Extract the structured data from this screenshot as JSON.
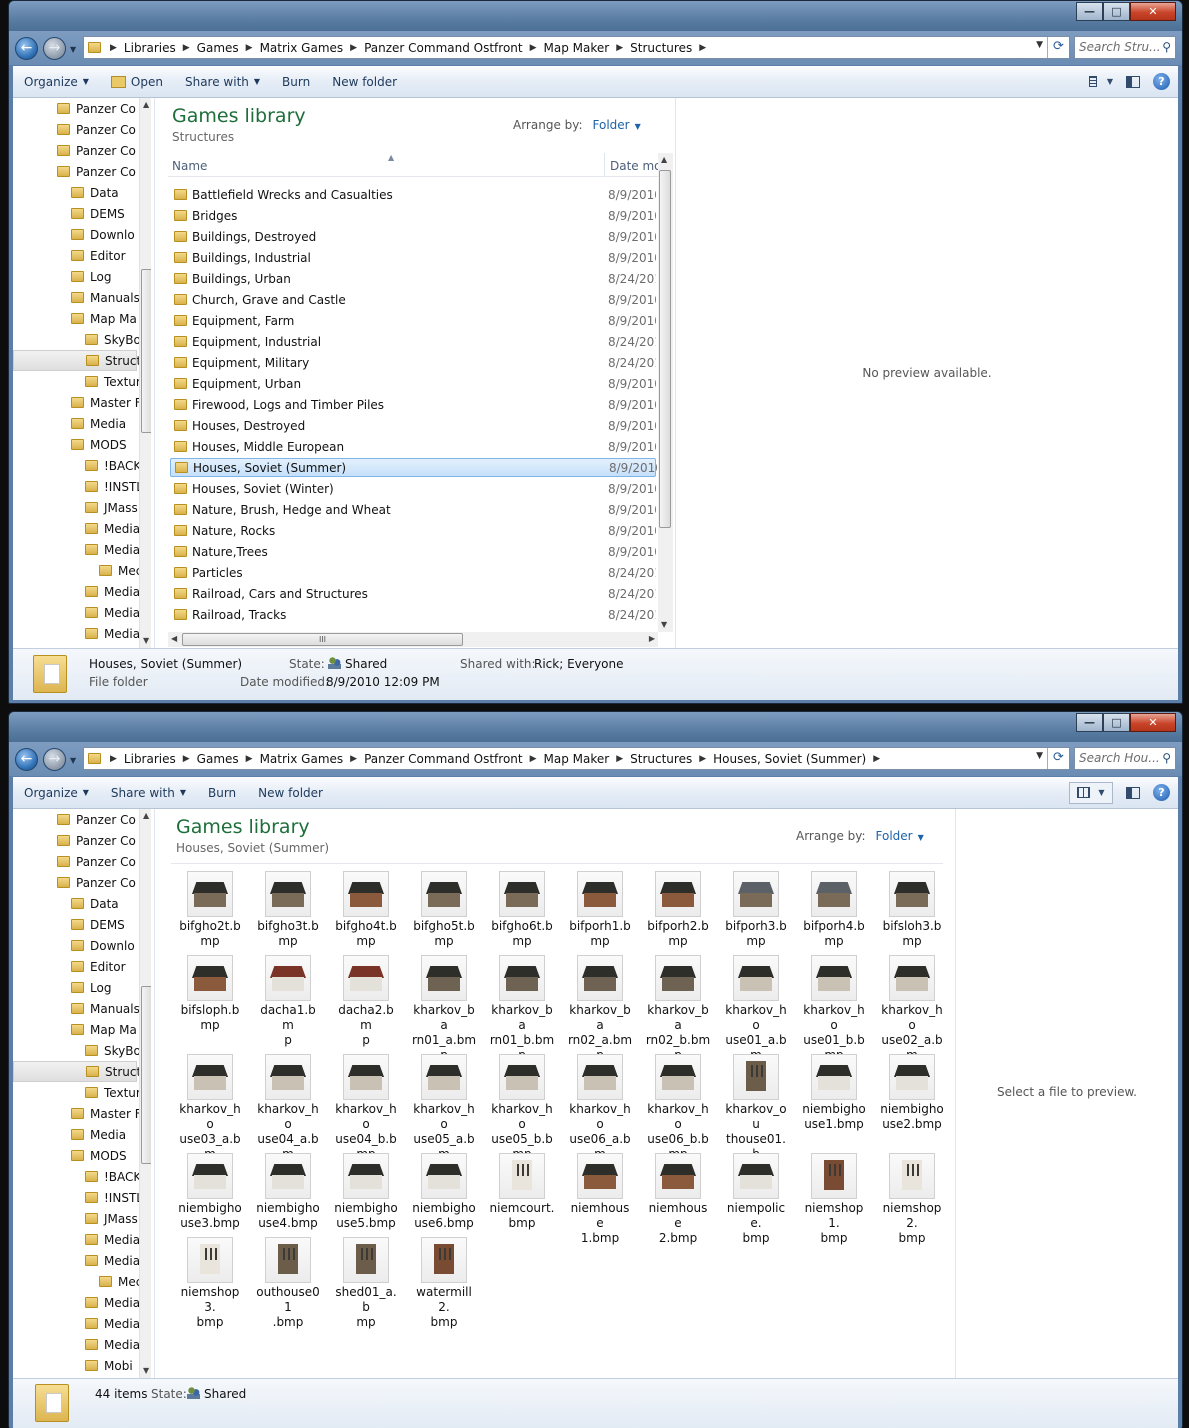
{
  "window1": {
    "address": [
      "Libraries",
      "Games",
      "Matrix Games",
      "Panzer Command Ostfront",
      "Map Maker",
      "Structures"
    ],
    "search_placeholder": "Search Stru...",
    "toolbar": {
      "organize": "Organize",
      "open": "Open",
      "share_with": "Share with",
      "burn": "Burn",
      "new_folder": "New folder"
    },
    "tree": [
      "Panzer Co",
      "Panzer Co",
      "Panzer Co",
      "Panzer Co",
      "Data",
      "DEMS",
      "Downlo",
      "Editor",
      "Log",
      "Manuals",
      "Map Ma",
      "SkyBo",
      "Struct",
      "Textur",
      "Master F",
      "Media",
      "MODS",
      "!BACK",
      "!INSTL",
      "JMass",
      "Media",
      "Media",
      "Mec",
      "Media",
      "Media",
      "Media"
    ],
    "library_title": "Games library",
    "library_sub": "Structures",
    "arrange_label": "Arrange by:",
    "arrange_value": "Folder",
    "col_name": "Name",
    "col_date": "Date mo",
    "files": [
      {
        "name": "Battlefield Wrecks and Casualties",
        "date": "8/9/2010"
      },
      {
        "name": "Bridges",
        "date": "8/9/2010"
      },
      {
        "name": "Buildings, Destroyed",
        "date": "8/9/2010"
      },
      {
        "name": "Buildings, Industrial",
        "date": "8/9/2010"
      },
      {
        "name": "Buildings, Urban",
        "date": "8/24/201"
      },
      {
        "name": "Church, Grave and Castle",
        "date": "8/9/2010"
      },
      {
        "name": "Equipment, Farm",
        "date": "8/9/2010"
      },
      {
        "name": "Equipment, Industrial",
        "date": "8/24/201"
      },
      {
        "name": "Equipment, Military",
        "date": "8/24/201"
      },
      {
        "name": "Equipment, Urban",
        "date": "8/9/2010"
      },
      {
        "name": "Firewood, Logs and Timber Piles",
        "date": "8/9/2010"
      },
      {
        "name": "Houses, Destroyed",
        "date": "8/9/2010"
      },
      {
        "name": "Houses, Middle European",
        "date": "8/9/2010"
      },
      {
        "name": "Houses, Soviet (Summer)",
        "date": "8/9/2010"
      },
      {
        "name": "Houses, Soviet (Winter)",
        "date": "8/9/2010"
      },
      {
        "name": "Nature, Brush, Hedge and Wheat",
        "date": "8/9/2010"
      },
      {
        "name": "Nature, Rocks",
        "date": "8/9/2010"
      },
      {
        "name": "Nature,Trees",
        "date": "8/9/2010"
      },
      {
        "name": "Particles",
        "date": "8/24/201"
      },
      {
        "name": "Railroad, Cars and Structures",
        "date": "8/24/201"
      },
      {
        "name": "Railroad, Tracks",
        "date": "8/24/201"
      }
    ],
    "preview_msg": "No preview available.",
    "details": {
      "name": "Houses, Soviet (Summer)",
      "type": "File folder",
      "state_label": "State:",
      "state_value": "Shared",
      "shared_label": "Shared with:",
      "shared_value": "Rick; Everyone",
      "modified_label": "Date modified:",
      "modified_value": "8/9/2010 12:09 PM"
    }
  },
  "window2": {
    "address": [
      "Libraries",
      "Games",
      "Matrix Games",
      "Panzer Command Ostfront",
      "Map Maker",
      "Structures",
      "Houses, Soviet (Summer)"
    ],
    "search_placeholder": "Search Hou...",
    "toolbar": {
      "organize": "Organize",
      "share_with": "Share with",
      "burn": "Burn",
      "new_folder": "New folder"
    },
    "tree": [
      "Panzer Co",
      "Panzer Co",
      "Panzer Co",
      "Panzer Co",
      "Data",
      "DEMS",
      "Downlo",
      "Editor",
      "Log",
      "Manuals",
      "Map Ma",
      "SkyBo",
      "Struct",
      "Textur",
      "Master F",
      "Media",
      "MODS",
      "!BACK",
      "!INSTL",
      "JMass",
      "Media",
      "Media",
      "Mec",
      "Media",
      "Media",
      "Media",
      "Mobi"
    ],
    "library_title": "Games library",
    "library_sub": "Houses, Soviet (Summer)",
    "arrange_label": "Arrange by:",
    "arrange_value": "Folder",
    "files": [
      "bifgho2t.bmp",
      "bifgho3t.bmp",
      "bifgho4t.bmp",
      "bifgho5t.bmp",
      "bifgho6t.bmp",
      "bifporh1.bmp",
      "bifporh2.bmp",
      "bifporh3.bmp",
      "bifporh4.bmp",
      "bifsloh3.bmp",
      "bifsloph.bmp",
      "dacha1.bmp",
      "dacha2.bmp",
      "kharkov_barn01_a.bmp",
      "kharkov_barn01_b.bmp",
      "kharkov_barn02_a.bmp",
      "kharkov_barn02_b.bmp",
      "kharkov_house01_a.bmp",
      "kharkov_house01_b.bmp",
      "kharkov_house02_a.bmp",
      "kharkov_house03_a.bmp",
      "kharkov_house04_a.bmp",
      "kharkov_house04_b.bmp",
      "kharkov_house05_a.bmp",
      "kharkov_house05_b.bmp",
      "kharkov_house06_a.bmp",
      "kharkov_house06_b.bmp",
      "kharkov_outhouse01.bmp",
      "niembighouse1.bmp",
      "niembighouse2.bmp",
      "niembighouse3.bmp",
      "niembighouse4.bmp",
      "niembighouse5.bmp",
      "niembighouse6.bmp",
      "niemcourt.bmp",
      "niemhouse1.bmp",
      "niemhouse2.bmp",
      "niempolice.bmp",
      "niemshop1.bmp",
      "niemshop2.bmp",
      "niemshop3.bmp",
      "outhouse01.bmp",
      "shed01_a.bmp",
      "watermill2.bmp"
    ],
    "file_labels": [
      [
        "bifgho2t.b",
        "mp"
      ],
      [
        "bifgho3t.b",
        "mp"
      ],
      [
        "bifgho4t.b",
        "mp"
      ],
      [
        "bifgho5t.b",
        "mp"
      ],
      [
        "bifgho6t.b",
        "mp"
      ],
      [
        "bifporh1.b",
        "mp"
      ],
      [
        "bifporh2.b",
        "mp"
      ],
      [
        "bifporh3.b",
        "mp"
      ],
      [
        "bifporh4.b",
        "mp"
      ],
      [
        "bifsloh3.b",
        "mp"
      ],
      [
        "bifsloph.b",
        "mp"
      ],
      [
        "dacha1.bm",
        "p"
      ],
      [
        "dacha2.bm",
        "p"
      ],
      [
        "kharkov_ba",
        "rn01_a.bmp"
      ],
      [
        "kharkov_ba",
        "rn01_b.bm",
        "p"
      ],
      [
        "kharkov_ba",
        "rn02_a.bmp"
      ],
      [
        "kharkov_ba",
        "rn02_b.bm",
        "p"
      ],
      [
        "kharkov_ho",
        "use01_a.bm",
        "p"
      ],
      [
        "kharkov_ho",
        "use01_b.b",
        "mp"
      ],
      [
        "kharkov_ho",
        "use02_a.bm",
        "p"
      ],
      [
        "kharkov_ho",
        "use03_a.bm",
        "p"
      ],
      [
        "kharkov_ho",
        "use04_a.bm",
        "p"
      ],
      [
        "kharkov_ho",
        "use04_b.b",
        "mp"
      ],
      [
        "kharkov_ho",
        "use05_a.bm",
        "p"
      ],
      [
        "kharkov_ho",
        "use05_b.b",
        "mp"
      ],
      [
        "kharkov_ho",
        "use06_a.bm",
        "p"
      ],
      [
        "kharkov_ho",
        "use06_b.b",
        "mp"
      ],
      [
        "kharkov_ou",
        "thouse01.b",
        "mp"
      ],
      [
        "niembigho",
        "use1.bmp"
      ],
      [
        "niembigho",
        "use2.bmp"
      ],
      [
        "niembigho",
        "use3.bmp"
      ],
      [
        "niembigho",
        "use4.bmp"
      ],
      [
        "niembigho",
        "use5.bmp"
      ],
      [
        "niembigho",
        "use6.bmp"
      ],
      [
        "niemcourt.",
        "bmp"
      ],
      [
        "niemhouse",
        "1.bmp"
      ],
      [
        "niemhouse",
        "2.bmp"
      ],
      [
        "niempolice.",
        "bmp"
      ],
      [
        "niemshop1.",
        "bmp"
      ],
      [
        "niemshop2.",
        "bmp"
      ],
      [
        "niemshop3.",
        "bmp"
      ],
      [
        "outhouse01",
        ".bmp"
      ],
      [
        "shed01_a.b",
        "mp"
      ],
      [
        "watermill2.",
        "bmp"
      ]
    ],
    "preview_msg": "Select a file to preview.",
    "details": {
      "count": "44 items",
      "state_label": "State:",
      "state_value": "Shared"
    }
  }
}
